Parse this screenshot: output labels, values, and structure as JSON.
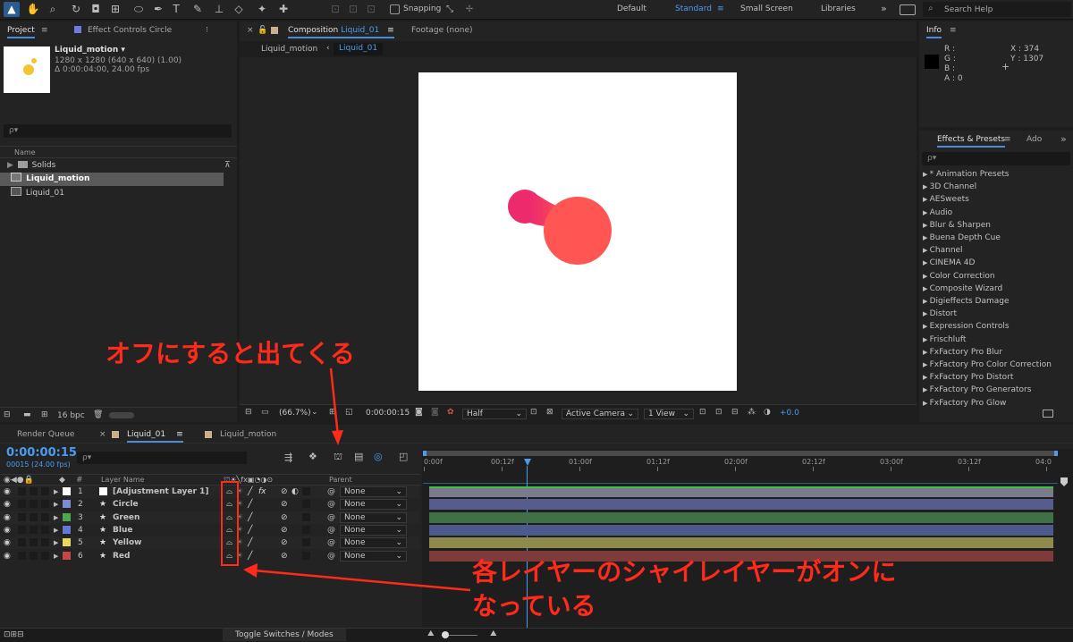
{
  "toolbar": {
    "snapping_label": "Snapping",
    "workspaces": [
      "Default",
      "Standard",
      "Small Screen",
      "Libraries"
    ],
    "active_workspace": "Standard",
    "search_help_placeholder": "Search Help",
    "more": "»"
  },
  "project_panel": {
    "tab_project": "Project",
    "tab_effect_controls": "Effect Controls Circle",
    "item_name": "Liquid_motion ▾",
    "item_info1": "1280 x 1280  (640 x 640) (1.00)",
    "item_info2": "Δ 0:00:04:00, 24.00 fps",
    "search_placeholder": "ρ▾",
    "col_name": "Name",
    "items": [
      {
        "name": "Solids",
        "type": "folder"
      },
      {
        "name": "Liquid_motion",
        "type": "comp",
        "selected": true
      },
      {
        "name": "Liquid_01",
        "type": "comp"
      }
    ],
    "bpc": "16 bpc"
  },
  "comp_panel": {
    "tab_label": "Composition",
    "tab_comp_name": "Liquid_01",
    "footage_tab": "Footage (none)",
    "breadcrumb1": "Liquid_motion",
    "breadcrumb2": "Liquid_01",
    "zoom": "(66.7%)",
    "timecode": "0:00:00:15",
    "resolution": "Half",
    "camera": "Active Camera",
    "view": "1 View",
    "exposure": "+0.0"
  },
  "info_panel": {
    "title": "Info",
    "r": "R :",
    "g": "G :",
    "b": "B :",
    "a": "A :  0",
    "x": "X : 374",
    "y": "Y : 1307"
  },
  "effects_panel": {
    "tab_effects": "Effects & Presets",
    "tab_ado": "Ado",
    "search_placeholder": "ρ▾",
    "items": [
      "* Animation Presets",
      "3D Channel",
      "AESweets",
      "Audio",
      "Blur & Sharpen",
      "Buena Depth Cue",
      "Channel",
      "CINEMA 4D",
      "Color Correction",
      "Composite Wizard",
      "Digieffects Damage",
      "Distort",
      "Expression Controls",
      "Frischluft",
      "FxFactory Pro Blur",
      "FxFactory Pro Color Correction",
      "FxFactory Pro Distort",
      "FxFactory Pro Generators",
      "FxFactory Pro Glow"
    ]
  },
  "timeline": {
    "tab_render_queue": "Render Queue",
    "tab_liquid_01": "Liquid_01",
    "tab_liquid_motion": "Liquid_motion",
    "timecode": "0:00:00:15",
    "frame_info": "00015 (24.00 fps)",
    "search_placeholder": "ρ▾",
    "col_number": "#",
    "col_layer_name": "Layer Name",
    "col_parent": "Parent",
    "ruler": [
      "0:00f",
      "00:12f",
      "01:00f",
      "01:12f",
      "02:00f",
      "02:12f",
      "03:00f",
      "03:12f",
      "04:0"
    ],
    "layers": [
      {
        "num": "1",
        "name": "[Adjustment Layer 1]",
        "color": "#ffffff",
        "bar": "#7a7a8c",
        "parent": "None",
        "star": false
      },
      {
        "num": "2",
        "name": "Circle",
        "color": "#7d8ad6",
        "bar": "#565d8c",
        "parent": "None",
        "star": true
      },
      {
        "num": "3",
        "name": "Green",
        "color": "#4ea64e",
        "bar": "#416f46",
        "parent": "None",
        "star": true
      },
      {
        "num": "4",
        "name": "Blue",
        "color": "#6478d6",
        "bar": "#4d5a8e",
        "parent": "None",
        "star": true
      },
      {
        "num": "5",
        "name": "Yellow",
        "color": "#e8d85c",
        "bar": "#8e8a4c",
        "parent": "None",
        "star": true
      },
      {
        "num": "6",
        "name": "Red",
        "color": "#c84646",
        "bar": "#7d3b3b",
        "parent": "None",
        "star": true
      }
    ],
    "toggle_label": "Toggle Switches / Modes"
  },
  "annotations": {
    "top": "オフにすると出てくる",
    "bottom_line1": "各レイヤーのシャイレイヤーがオンに",
    "bottom_line2": "なっている",
    "color": "#ff2a1a"
  }
}
